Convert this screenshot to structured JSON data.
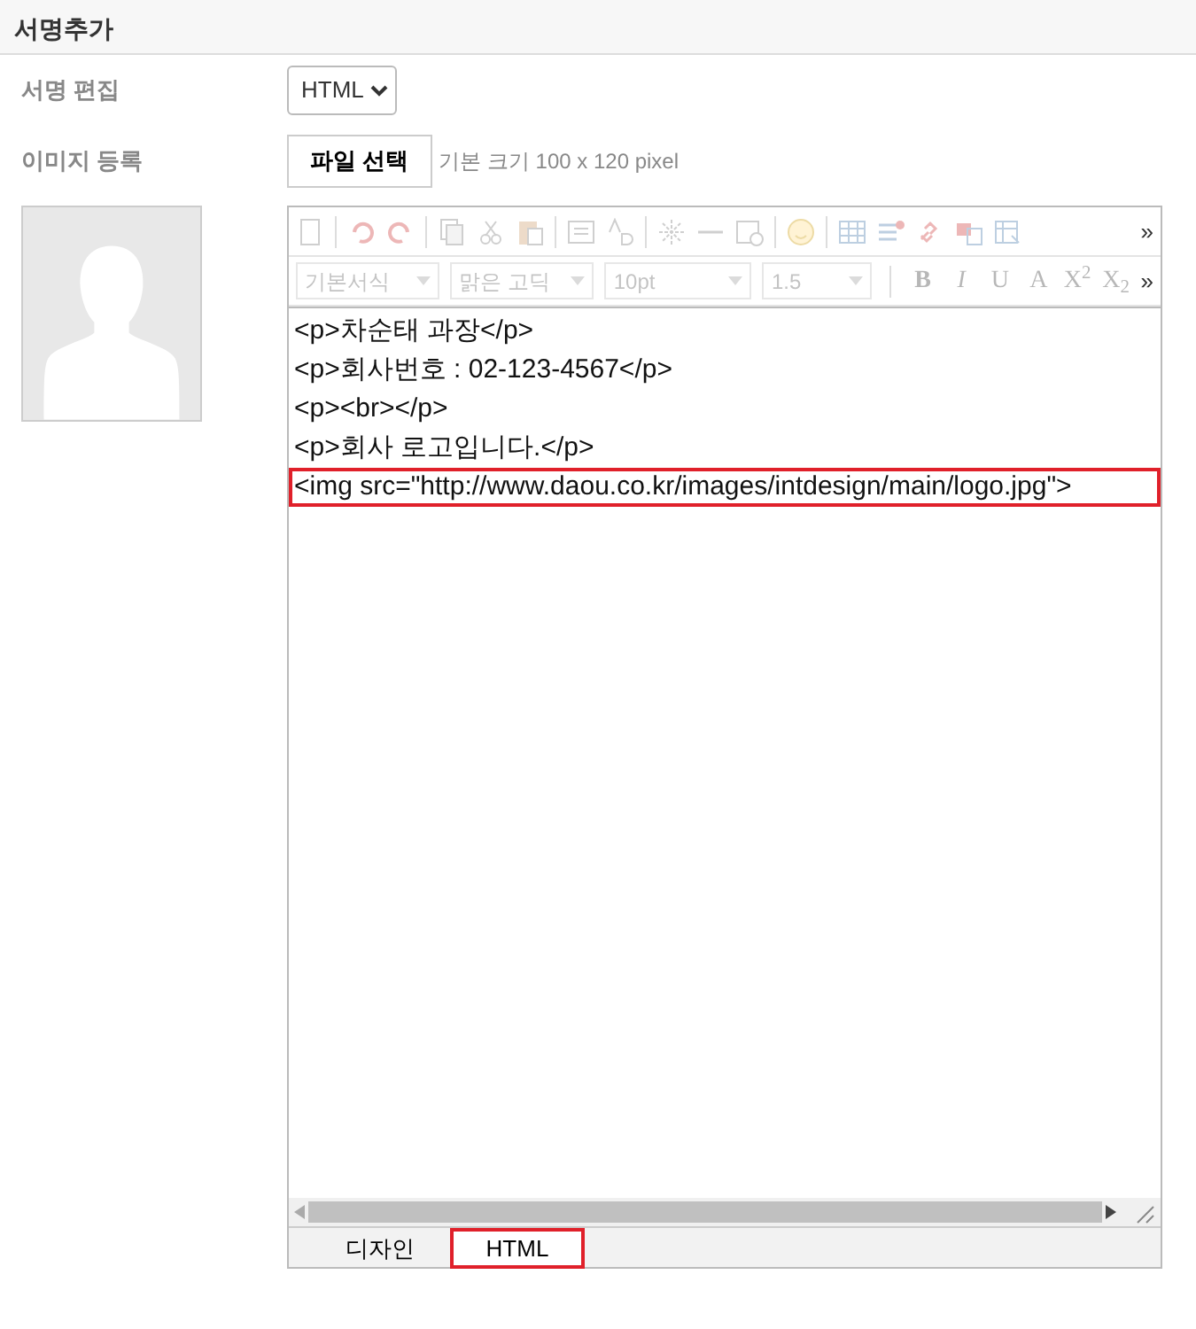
{
  "title": "서명추가",
  "form": [
    {
      "kind": "select",
      "label": "서명 편집",
      "value": "HTML"
    },
    {
      "kind": "file",
      "label": "이미지 등록",
      "button": "파일 선택",
      "hint": "기본 크기 100 x 120 pixel"
    }
  ],
  "editor": {
    "toolbar_disabled": true,
    "more": [
      "»",
      "»"
    ],
    "selects": [
      {
        "value": "기본서식"
      },
      {
        "value": "맑은 고딕"
      },
      {
        "value": "10pt"
      },
      {
        "value": "1.5"
      }
    ],
    "format_buttons": [
      "**B**",
      "*I*",
      "U",
      "A",
      "X$^{2}$",
      "X$_{2}$"
    ],
    "code_lines": [
      {
        "text": "<p>차순태 과장</p>",
        "highlighted": false
      },
      {
        "text": "<p>회사번호 : 02-123-4567</p>",
        "highlighted": false
      },
      {
        "text": "<p><br></p>",
        "highlighted": false
      },
      {
        "text": "<p>회사 로고입니다.</p>",
        "highlighted": false
      },
      {
        "text": "<img src=\"http://www.daou.co.kr/images/intdesign/main/logo.jpg\">",
        "highlighted": true
      }
    ],
    "tabs": [
      {
        "label": "디자인",
        "selected": false,
        "highlighted": false
      },
      {
        "label": "HTML",
        "selected": true,
        "highlighted": true
      }
    ]
  }
}
